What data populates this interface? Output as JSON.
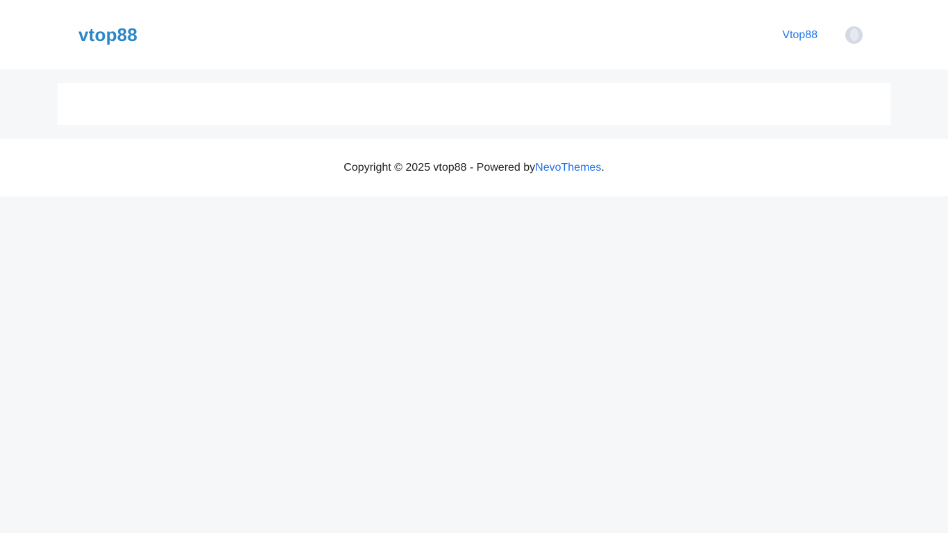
{
  "header": {
    "site_title": "vtop88",
    "nav_link": "Vtop88"
  },
  "footer": {
    "copyright_prefix": "Copyright © 2025 vtop88 - Powered by ",
    "theme_link": "NevoThemes",
    "suffix": "."
  },
  "colors": {
    "brand": "#2a86c6",
    "link": "#1e73e8",
    "page_bg": "#f6f7f9"
  },
  "icons": {
    "avatar": "user-avatar-icon"
  }
}
